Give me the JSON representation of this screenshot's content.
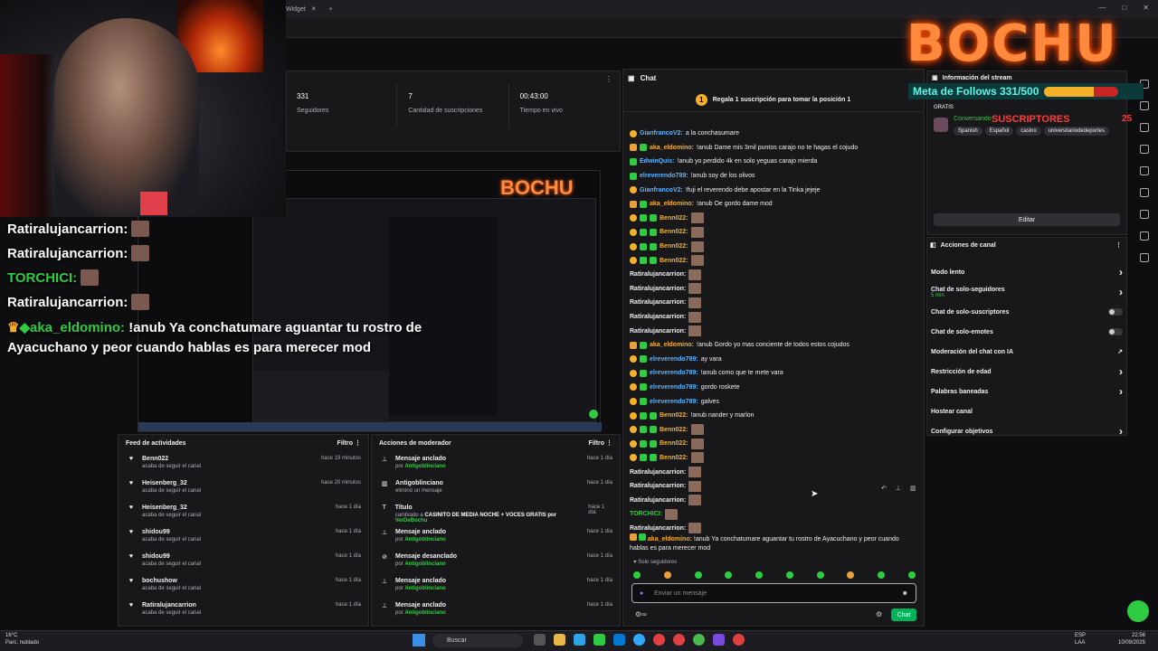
{
  "browser": {
    "tab_title": "Widget",
    "new_tab": "+",
    "controls": [
      "—",
      "□",
      "✕"
    ]
  },
  "stats": [
    {
      "value": "331",
      "label": "Seguidores"
    },
    {
      "value": "7",
      "label": "Cantidad de suscripciones"
    },
    {
      "value": "00:43:00",
      "label": "Tiempo en vivo"
    }
  ],
  "overlay": {
    "lines": [
      {
        "name": "Ratiralujancarrion:",
        "color": "#ffffff"
      },
      {
        "name": "Ratiralujancarrion:",
        "color": "#ffffff"
      },
      {
        "name": "TORCHICI:",
        "color": "#2ecc40"
      },
      {
        "name": "Ratiralujancarrion:",
        "color": "#ffffff"
      }
    ],
    "highlight_name": "aka_eldomino:",
    "highlight_msg": "!anub Ya conchatumare aguantar tu rostro de Ayacuchano y peor cuando hablas es para merecer mod",
    "logo": "BOCHU",
    "follows_text": "Meta de Follows 331/500",
    "follows_progress": 0.662,
    "subs_label": "SUSCRIPTORES",
    "subs_count": "25",
    "conversando": "Conversando"
  },
  "chat": {
    "title": "Chat",
    "pinned": "Regala 1 suscripción para tomar la posición 1",
    "pin_badge": "1",
    "messages": [
      {
        "user": "GianfrancoV2:",
        "color": "#5ab4ff",
        "msg": "a la conchasumare",
        "badges": [
          "y"
        ],
        "emote": false
      },
      {
        "user": "aka_eldomino:",
        "color": "#f5b02a",
        "msg": "!anub Dame mis 3mil puntos carajo no te hagas el cojudo",
        "badges": [
          "c",
          "g"
        ],
        "emote": false
      },
      {
        "user": "EdwinQuis:",
        "color": "#5ab4ff",
        "msg": "!anub yo perdido 4k en solo yeguas carajo mierda",
        "badges": [
          "g"
        ],
        "emote": false
      },
      {
        "user": "elreverendo789:",
        "color": "#5ab4ff",
        "msg": "!anub soy de los olivos",
        "badges": [
          "g"
        ],
        "emote": false
      },
      {
        "user": "GianfrancoV2:",
        "color": "#5ab4ff",
        "msg": "!fuji el reverendo debe apostar en la Tinka jejeje",
        "badges": [
          "y"
        ],
        "emote": false
      },
      {
        "user": "aka_eldomino:",
        "color": "#f5b02a",
        "msg": "!anub Oe gordo dame mod",
        "badges": [
          "c",
          "g"
        ],
        "emote": false
      },
      {
        "user": "Benn022:",
        "color": "#f5b02a",
        "msg": "",
        "badges": [
          "y",
          "g",
          "g"
        ],
        "emote": true
      },
      {
        "user": "Benn022:",
        "color": "#f5b02a",
        "msg": "",
        "badges": [
          "y",
          "g",
          "g"
        ],
        "emote": true
      },
      {
        "user": "Benn022:",
        "color": "#f5b02a",
        "msg": "",
        "badges": [
          "y",
          "g",
          "g"
        ],
        "emote": true
      },
      {
        "user": "Benn022:",
        "color": "#f5b02a",
        "msg": "",
        "badges": [
          "y",
          "g",
          "g"
        ],
        "emote": true
      },
      {
        "user": "Ratiralujancarrion:",
        "color": "#efeff1",
        "msg": "",
        "badges": [],
        "emote": true
      },
      {
        "user": "Ratiralujancarrion:",
        "color": "#efeff1",
        "msg": "",
        "badges": [],
        "emote": true
      },
      {
        "user": "Ratiralujancarrion:",
        "color": "#efeff1",
        "msg": "",
        "badges": [],
        "emote": true
      },
      {
        "user": "Ratiralujancarrion:",
        "color": "#efeff1",
        "msg": "",
        "badges": [],
        "emote": true
      },
      {
        "user": "Ratiralujancarrion:",
        "color": "#efeff1",
        "msg": "",
        "badges": [],
        "emote": true
      },
      {
        "user": "aka_eldomino:",
        "color": "#f5b02a",
        "msg": "!anub Gordo yo mas conciente de todos estos cojudos",
        "badges": [
          "c",
          "g"
        ],
        "emote": false
      },
      {
        "user": "elreverendo789:",
        "color": "#5ab4ff",
        "msg": "ay vara",
        "badges": [
          "y",
          "g"
        ],
        "emote": false
      },
      {
        "user": "elreverendo789:",
        "color": "#5ab4ff",
        "msg": "!anub como que te mete vara",
        "badges": [
          "y",
          "g"
        ],
        "emote": false
      },
      {
        "user": "elreverendo789:",
        "color": "#5ab4ff",
        "msg": "gordo roskete",
        "badges": [
          "y",
          "g"
        ],
        "emote": false
      },
      {
        "user": "elreverendo789:",
        "color": "#5ab4ff",
        "msg": "galves",
        "badges": [
          "y",
          "g"
        ],
        "emote": false
      },
      {
        "user": "Benn022:",
        "color": "#f5b02a",
        "msg": "!anub nander y marlon",
        "badges": [
          "y",
          "g",
          "g"
        ],
        "emote": false
      },
      {
        "user": "Benn022:",
        "color": "#f5b02a",
        "msg": "",
        "badges": [
          "y",
          "g",
          "g"
        ],
        "emote": true
      },
      {
        "user": "Benn022:",
        "color": "#f5b02a",
        "msg": "",
        "badges": [
          "y",
          "g",
          "g"
        ],
        "emote": true
      },
      {
        "user": "Benn022:",
        "color": "#f5b02a",
        "msg": "",
        "badges": [
          "y",
          "g",
          "g"
        ],
        "emote": true
      },
      {
        "user": "Ratiralujancarrion:",
        "color": "#efeff1",
        "msg": "",
        "badges": [],
        "emote": true
      },
      {
        "user": "Ratiralujancarrion:",
        "color": "#efeff1",
        "msg": "",
        "badges": [],
        "emote": true
      },
      {
        "user": "Ratiralujancarrion:",
        "color": "#efeff1",
        "msg": "",
        "badges": [],
        "emote": true
      },
      {
        "user": "TORCHICI:",
        "color": "#2ecc40",
        "msg": "",
        "badges": [],
        "emote": true
      },
      {
        "user": "Ratiralujancarrion:",
        "color": "#efeff1",
        "msg": "",
        "badges": [],
        "emote": true
      }
    ],
    "last_user": "aka_eldomino:",
    "last_msg": "!anub Ya conchatumare aguantar tu rostro de Ayacuchano y peor cuando hablas es para merecer mod",
    "solo_seguidores": "Solo seguidores",
    "input_placeholder": "Enviar un mensaje",
    "send_label": "Chat"
  },
  "sidebar": {
    "info_title": "Información del stream",
    "gratis": "GRATIS",
    "tags": [
      "Spanish",
      "Español",
      "casino",
      "universitariodedeportes"
    ],
    "edit_label": "Editar",
    "actions_title": "Acciones de canal",
    "actions": [
      {
        "label": "Modo lento",
        "sub": "",
        "ctrl": "chevron"
      },
      {
        "label": "Chat de solo-seguidores",
        "sub": "5 min",
        "ctrl": "chevron"
      },
      {
        "label": "Chat de solo-suscriptores",
        "sub": "",
        "ctrl": "toggle"
      },
      {
        "label": "Chat de solo-emotes",
        "sub": "",
        "ctrl": "toggle"
      },
      {
        "label": "Moderación del chat con IA",
        "sub": "",
        "ctrl": "ext"
      },
      {
        "label": "Restricción de edad",
        "sub": "",
        "ctrl": "chevron"
      },
      {
        "label": "Palabras baneadas",
        "sub": "",
        "ctrl": "chevron"
      },
      {
        "label": "Hostear canal",
        "sub": "",
        "ctrl": "none"
      },
      {
        "label": "Configurar objetivos",
        "sub": "",
        "ctrl": "chevron"
      }
    ]
  },
  "feed": {
    "title": "Feed de actividades",
    "filter": "Filtro",
    "items": [
      {
        "name": "Benn022",
        "sub": "acaba de seguir el canal",
        "time": "hace 19 minutos"
      },
      {
        "name": "Heisenberg_32",
        "sub": "acaba de seguir el canal",
        "time": "hace 20 minutos"
      },
      {
        "name": "Heisenberg_32",
        "sub": "acaba de seguir el canal",
        "time": "hace 1 día"
      },
      {
        "name": "shidou99",
        "sub": "acaba de seguir el canal",
        "time": "hace 1 día"
      },
      {
        "name": "shidou99",
        "sub": "acaba de seguir el canal",
        "time": "hace 1 día"
      },
      {
        "name": "bochushow",
        "sub": "acaba de seguir el canal",
        "time": "hace 1 día"
      },
      {
        "name": "Ratiralujancarrion",
        "sub": "acaba de seguir el canal",
        "time": "hace 1 día"
      }
    ]
  },
  "mods": {
    "title": "Acciones de moderador",
    "filter": "Filtro",
    "items": [
      {
        "icon": "pin",
        "title": "Mensaje anclado",
        "pre": "por ",
        "who": "Antigoblinciano",
        "post": "",
        "time": "hace 1 día"
      },
      {
        "icon": "trash",
        "title": "Antigoblinciano",
        "pre": "eliminó un mensaje",
        "who": "",
        "post": "",
        "time": "hace 1 día"
      },
      {
        "icon": "text",
        "title": "Título",
        "pre": "cambiado a ",
        "who": "VerDeBochu",
        "post": "CASINITO DE MEDIA NOCHE + VOCES GRATIS por ",
        "time": "hace 1 día"
      },
      {
        "icon": "pin",
        "title": "Mensaje anclado",
        "pre": "por ",
        "who": "Antigoblinciano",
        "post": "",
        "time": "hace 1 día"
      },
      {
        "icon": "unpin",
        "title": "Mensaje desanclado",
        "pre": "por ",
        "who": "Antigoblinciano",
        "post": "",
        "time": "hace 1 día"
      },
      {
        "icon": "pin",
        "title": "Mensaje anclado",
        "pre": "por ",
        "who": "Antigoblinciano",
        "post": "",
        "time": "hace 1 día"
      },
      {
        "icon": "pin",
        "title": "Mensaje anclado",
        "pre": "por ",
        "who": "Antigoblinciano",
        "post": "",
        "time": "hace 1 día"
      }
    ]
  },
  "taskbar": {
    "weather_temp": "16°C",
    "weather_desc": "Parc. nublado",
    "search": "Buscar",
    "lang1": "ESP",
    "lang2": "LAA",
    "time": "22:56",
    "date": "10/09/2025"
  }
}
